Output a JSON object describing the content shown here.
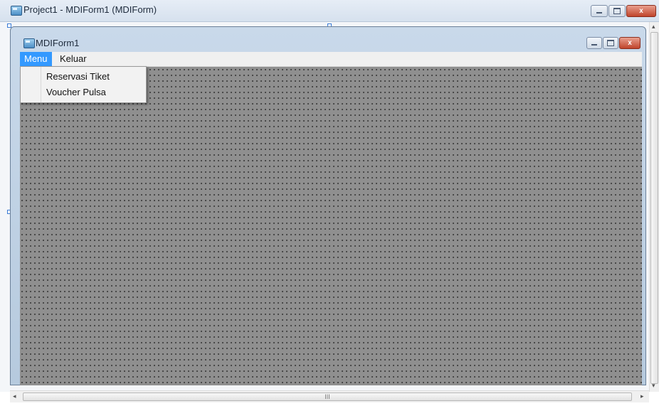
{
  "outer_window": {
    "title": "Project1 - MDIForm1 (MDIForm)",
    "icon": "vb-form-icon",
    "minimize_label": "–",
    "maximize_label": "□",
    "close_label": "x"
  },
  "mdi_form": {
    "title": "MDIForm1",
    "icon": "vb-form-icon",
    "close_label": "x"
  },
  "menubar": {
    "items": [
      {
        "label": "Menu",
        "active": true
      },
      {
        "label": "Keluar",
        "active": false
      }
    ]
  },
  "dropdown": {
    "items": [
      {
        "label": "Reservasi Tiket"
      },
      {
        "label": "Voucher Pulsa"
      }
    ]
  },
  "scrollbars": {
    "horizontal_thumb_grip": "III",
    "left_arrow": "◂",
    "right_arrow": "▸"
  },
  "colors": {
    "menu_active": "#3399ff",
    "client_area": "#8f8f8f",
    "close_button": "#c0442b"
  }
}
